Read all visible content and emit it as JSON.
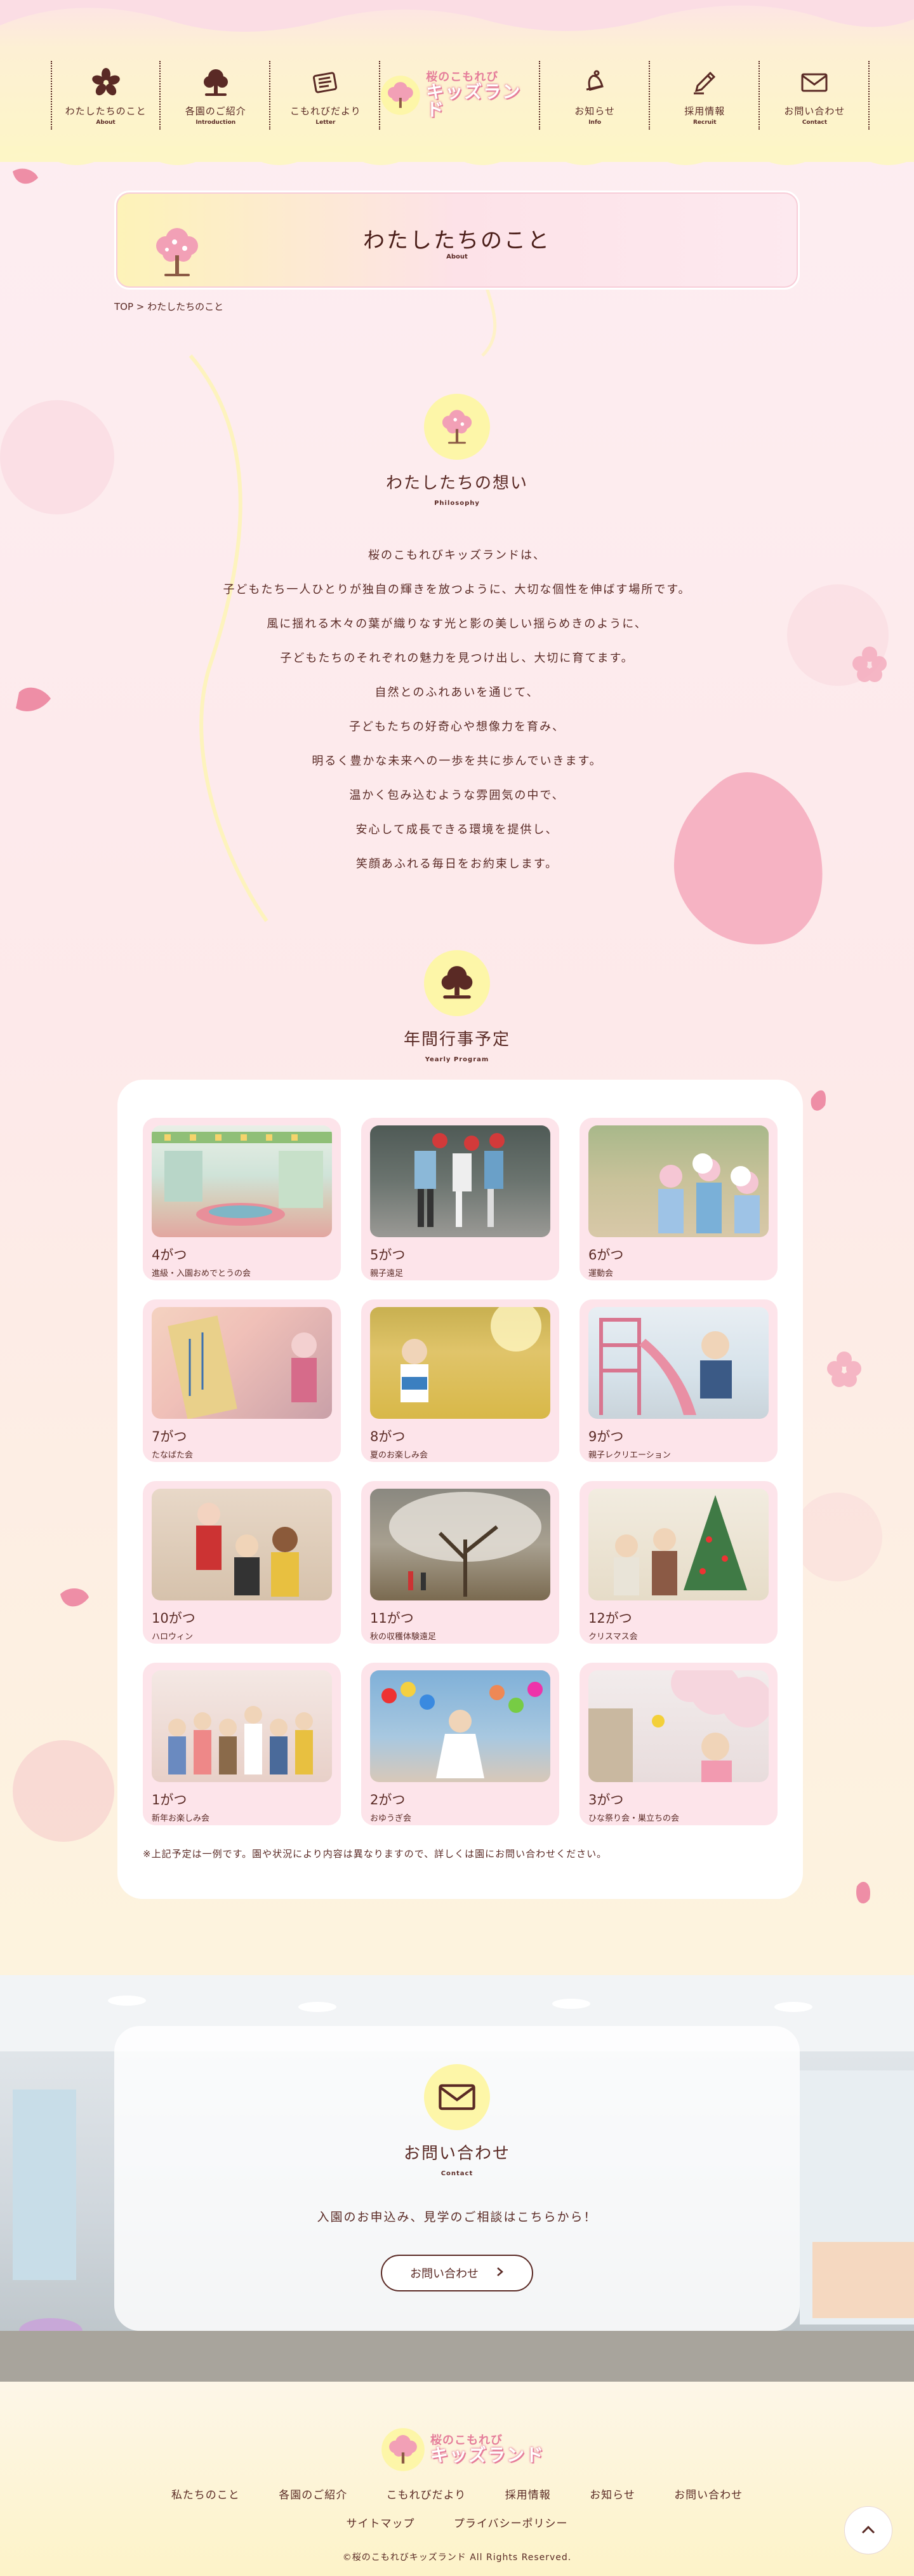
{
  "header": {
    "nav": [
      {
        "label": "わたしたちのこと",
        "sub": "About",
        "icon": "sakura-flower-icon"
      },
      {
        "label": "各園のご紹介",
        "sub": "Introduction",
        "icon": "tree-icon"
      },
      {
        "label": "こもれびだより",
        "sub": "Letter",
        "icon": "newspaper-icon"
      },
      {
        "label": "お知らせ",
        "sub": "Info",
        "icon": "bell-icon"
      },
      {
        "label": "採用情報",
        "sub": "Recruit",
        "icon": "pen-icon"
      },
      {
        "label": "お問い合わせ",
        "sub": "Contact",
        "icon": "envelope-icon"
      }
    ],
    "logo": {
      "top": "桜のこもれび",
      "main": "キッズランド"
    }
  },
  "page_title": {
    "title": "わたしたちのこと",
    "sub": "About"
  },
  "breadcrumb": {
    "home": "TOP",
    "separator": ">",
    "current": "わたしたちのこと"
  },
  "philosophy": {
    "title": "わたしたちの想い",
    "sub": "Philosophy",
    "lines": [
      "桜のこもれびキッズランドは、",
      "子どもたち一人ひとりが独自の輝きを放つように、大切な個性を伸ばす場所です。",
      "風に揺れる木々の葉が織りなす光と影の美しい揺らめきのように、",
      "子どもたちのそれぞれの魅力を見つけ出し、大切に育てます。",
      "自然とのふれあいを通じて、",
      "子どもたちの好奇心や想像力を育み、",
      "明るく豊かな未来への一歩を共に歩んでいきます。",
      "温かく包み込むような雰囲気の中で、",
      "安心して成長できる環境を提供し、",
      "笑顔あふれる毎日をお約束します。"
    ]
  },
  "program": {
    "title": "年間行事予定",
    "sub": "Yearly Program",
    "months": [
      {
        "month": "4がつ",
        "event": "進級・入園おめでとうの会",
        "photo": "classroom-photo"
      },
      {
        "month": "5がつ",
        "event": "親子遠足",
        "photo": "children-walking-photo"
      },
      {
        "month": "6がつ",
        "event": "運動会",
        "photo": "sports-day-photo"
      },
      {
        "month": "7がつ",
        "event": "たなばた会",
        "photo": "tanabata-photo"
      },
      {
        "month": "8がつ",
        "event": "夏のお楽しみ会",
        "photo": "summer-field-photo"
      },
      {
        "month": "9がつ",
        "event": "親子レクリエーション",
        "photo": "playground-slide-photo"
      },
      {
        "month": "10がつ",
        "event": "ハロウィン",
        "photo": "halloween-photo"
      },
      {
        "month": "11がつ",
        "event": "秋の収穫体験遠足",
        "photo": "autumn-tree-photo"
      },
      {
        "month": "12がつ",
        "event": "クリスマス会",
        "photo": "christmas-photo"
      },
      {
        "month": "1がつ",
        "event": "新年お楽しみ会",
        "photo": "new-year-photo"
      },
      {
        "month": "2がつ",
        "event": "おゆうぎ会",
        "photo": "recital-photo"
      },
      {
        "month": "3がつ",
        "event": "ひな祭り会・巣立ちの会",
        "photo": "cherry-blossom-photo"
      }
    ],
    "note": "※上記予定は一例です。園や状況により内容は異なりますので、詳しくは園にお問い合わせください。"
  },
  "contact": {
    "title": "お問い合わせ",
    "sub": "Contact",
    "text": "入園のお申込み、見学のご相談はこちらから！",
    "button": "お問い合わせ",
    "button_icon": "chevron-right-icon"
  },
  "footer": {
    "links_row1": [
      "私たちのこと",
      "各園のご紹介",
      "こもれびだより",
      "採用情報",
      "お知らせ",
      "お問い合わせ"
    ],
    "links_row2": [
      "サイトマップ",
      "プライバシーポリシー"
    ],
    "copyright": "©桜のこもれびキッズランド All Rights Reserved.",
    "page_top_icon": "chevron-up-icon"
  },
  "colors": {
    "text": "#5a2a25",
    "accent_pink": "#e57d9a",
    "yellow": "#fdf6a8",
    "card_pink": "#fde4ea"
  }
}
